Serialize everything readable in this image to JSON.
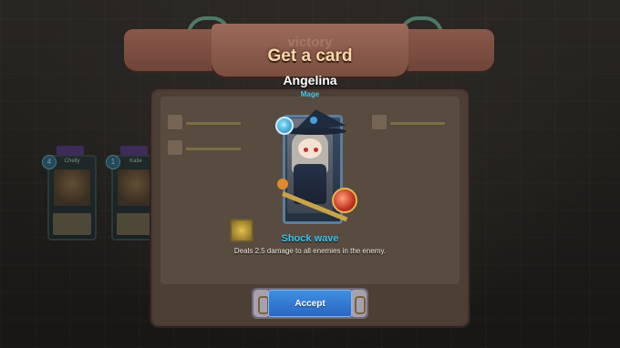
{
  "header": {
    "ghost_label": "victory",
    "title": "Get a card"
  },
  "hero": {
    "name": "Angelina",
    "class": "Mage"
  },
  "skill": {
    "name": "Shock wave",
    "description": "Deals 2.5 damage to all enemies in the enemy."
  },
  "accept_label": "Accept",
  "background_cards": [
    {
      "name": "Chelly",
      "level": "4"
    },
    {
      "name": "Katie",
      "level": "1"
    }
  ],
  "colors": {
    "accent_blue": "#3ec6f2",
    "title_gold": "#f3d9a8",
    "button_blue": "#2a66c4"
  },
  "icons": {
    "element": "water-element-icon",
    "reward": "gold-coin-icon"
  }
}
